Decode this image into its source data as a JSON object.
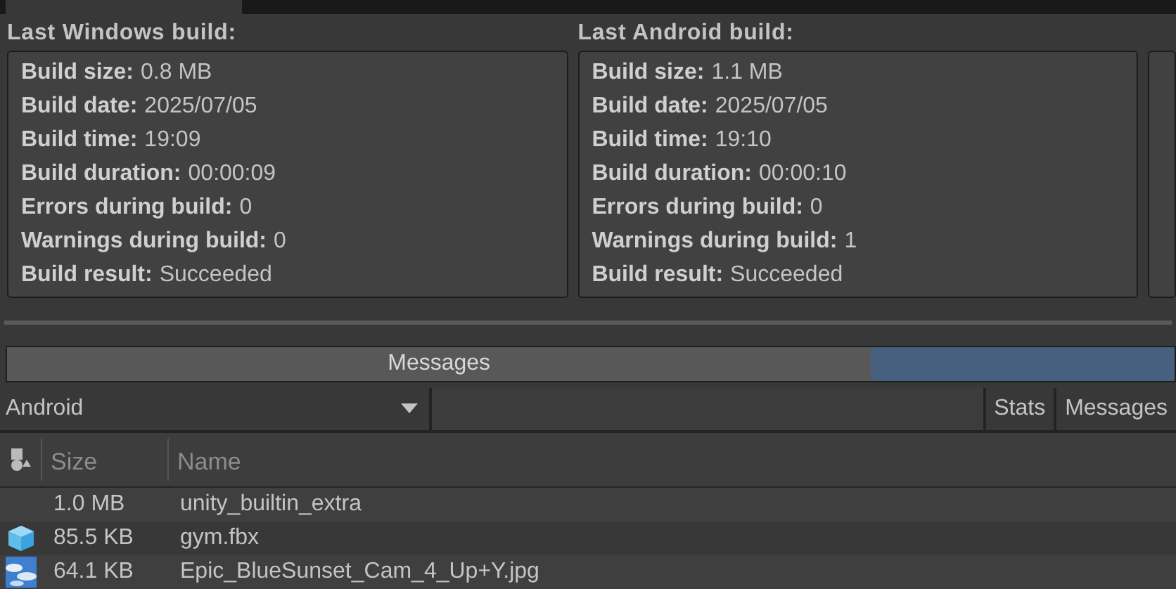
{
  "builds": [
    {
      "title": "Last Windows build:",
      "fields": [
        {
          "label": "Build size:",
          "value": "0.8 MB"
        },
        {
          "label": "Build date:",
          "value": "2025/07/05"
        },
        {
          "label": "Build time:",
          "value": "19:09"
        },
        {
          "label": "Build duration:",
          "value": "00:00:09"
        },
        {
          "label": "Errors during build:",
          "value": "0"
        },
        {
          "label": "Warnings during build:",
          "value": "0"
        },
        {
          "label": "Build result:",
          "value": "Succeeded"
        }
      ]
    },
    {
      "title": "Last Android build:",
      "fields": [
        {
          "label": "Build size:",
          "value": "1.1 MB"
        },
        {
          "label": "Build date:",
          "value": "2025/07/05"
        },
        {
          "label": "Build time:",
          "value": "19:10"
        },
        {
          "label": "Build duration:",
          "value": "00:00:10"
        },
        {
          "label": "Errors during build:",
          "value": "0"
        },
        {
          "label": "Warnings during build:",
          "value": "1"
        },
        {
          "label": "Build result:",
          "value": "Succeeded"
        }
      ]
    }
  ],
  "split_bar": {
    "label": "Messages",
    "level": 0.74
  },
  "toolbar": {
    "platform": "Android",
    "buttons": [
      {
        "label": "Stats"
      },
      {
        "label": "Messages"
      }
    ]
  },
  "table": {
    "columns": [
      "Size",
      "Name"
    ],
    "rows": [
      {
        "kind": "none",
        "size": "1.0 MB",
        "name": "unity_builtin_extra"
      },
      {
        "kind": "model",
        "size": "85.5 KB",
        "name": "gym.fbx"
      },
      {
        "kind": "picture",
        "size": "64.1 KB",
        "name": "Epic_BlueSunset_Cam_4_Up+Y.jpg"
      }
    ]
  }
}
